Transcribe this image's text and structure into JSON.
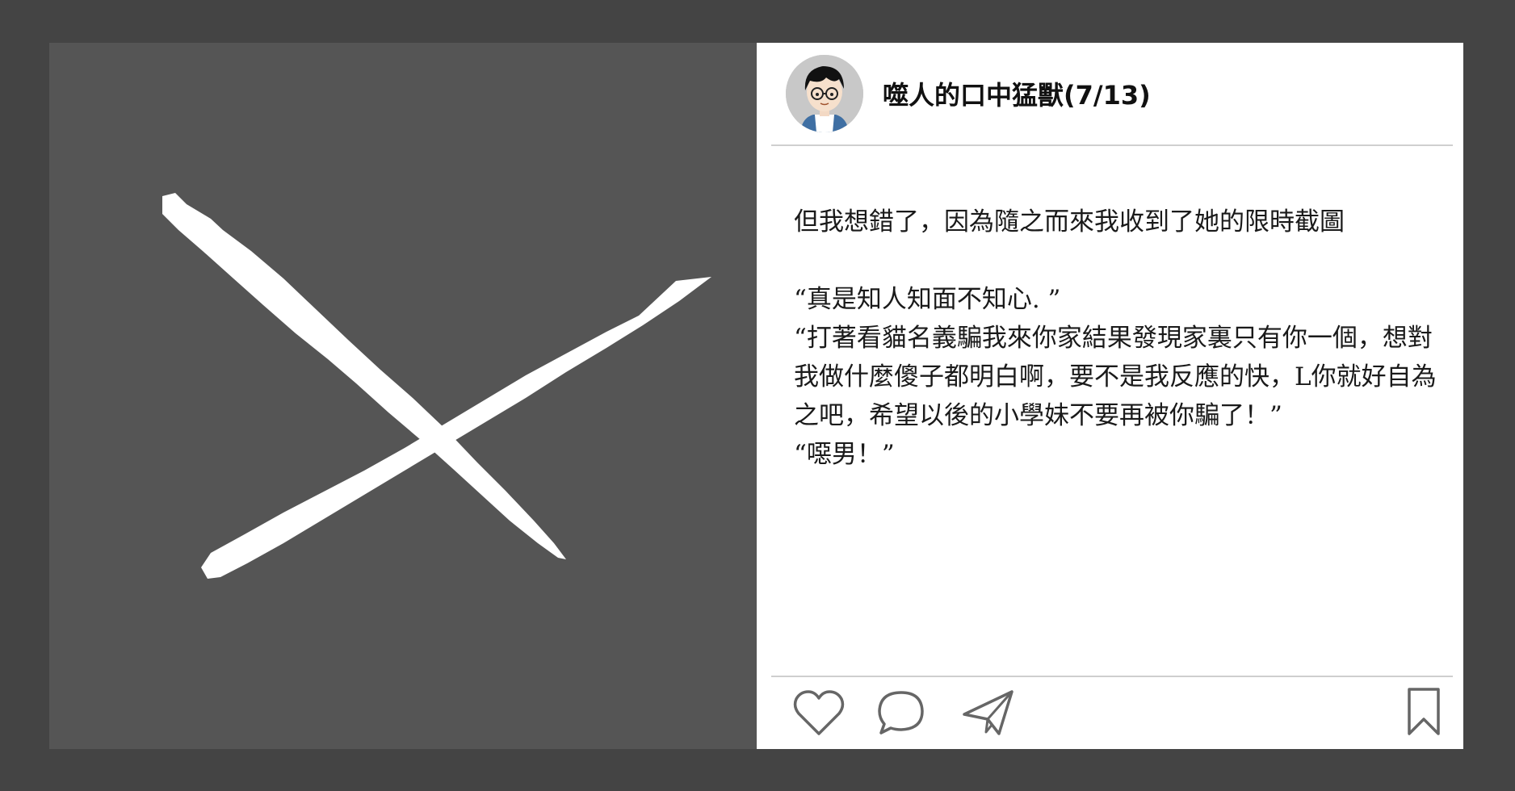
{
  "post": {
    "username": "噬人的口中猛獸(7/13)",
    "paragraphs": [
      "但我想錯了，因為隨之而來我收到了她的限時截圖",
      "",
      "“真是知人知面不知心. ”",
      "“打著看貓名義騙我來你家結果發現家裏只有你一個，想對我做什麼傻子都明白啊，要不是我反應的快，L你就好自為之吧，希望以後的小學妹不要再被你騙了！”",
      "“噁男！”"
    ]
  },
  "icons": {
    "like": "heart-icon",
    "comment": "comment-bubble-icon",
    "share": "paper-plane-icon",
    "save": "bookmark-icon",
    "image": "x-mark-brush-icon"
  },
  "colors": {
    "outer_background": "#444444",
    "image_background": "#555555",
    "post_background": "#ffffff",
    "divider": "#cfcfcf",
    "icon_stroke": "#666666",
    "mark": "#ffffff"
  }
}
